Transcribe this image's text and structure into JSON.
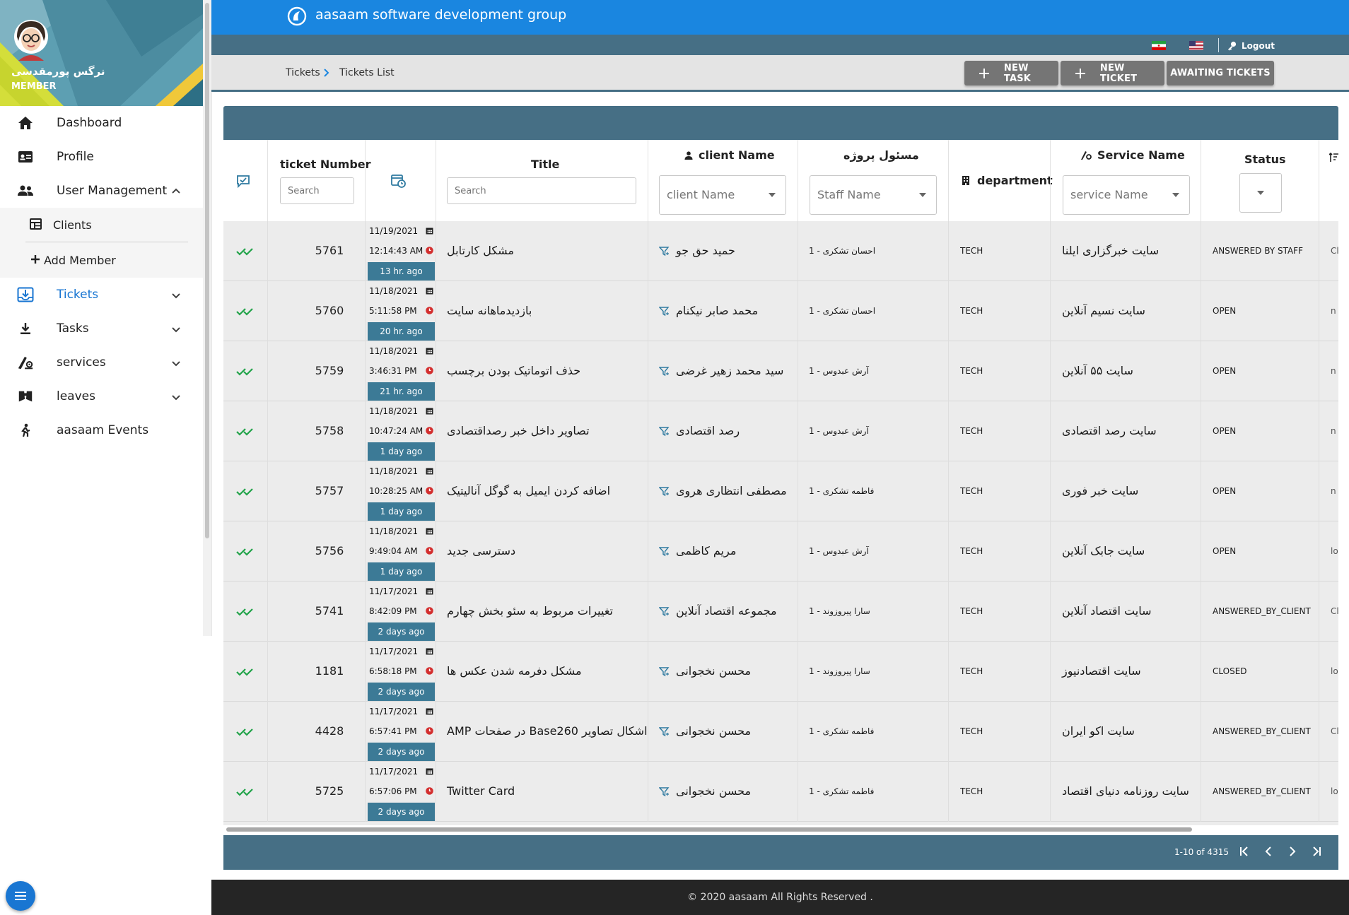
{
  "app": {
    "title": "aasaam software development group"
  },
  "sidebar": {
    "user_name": "نرگس پورمقدسی",
    "user_role": "MEMBER",
    "items": [
      {
        "label": "Dashboard",
        "icon": "home-icon"
      },
      {
        "label": "Profile",
        "icon": "id-card-icon"
      },
      {
        "label": "User Management",
        "icon": "users-icon",
        "expanded": true
      },
      {
        "label": "Tickets",
        "icon": "ticket-inbox-icon",
        "active": true
      },
      {
        "label": "Tasks",
        "icon": "task-icon"
      },
      {
        "label": "services",
        "icon": "services-icon"
      },
      {
        "label": "leaves",
        "icon": "leaves-icon"
      },
      {
        "label": "aasaam Events",
        "icon": "events-icon"
      }
    ],
    "sub_items": [
      {
        "label": "Clients",
        "icon": "table-icon"
      },
      {
        "label": "Add Member",
        "icon": "plus-icon"
      }
    ]
  },
  "header": {
    "logout_label": "Logout"
  },
  "breadcrumb": {
    "root": "Tickets",
    "current": "Tickets List"
  },
  "toolbar": {
    "new_task": "NEW TASK",
    "new_ticket": "NEW TICKET",
    "awaiting": "AWAITING TICKETS"
  },
  "table": {
    "headers": {
      "ticket_number": "ticket Number",
      "title": "Title",
      "client_name": "client Name",
      "staff": "مسئول پروژه",
      "department": "department",
      "service_name": "Service Name",
      "status": "Status"
    },
    "filters": {
      "ticket_search": "Search",
      "title_search": "Search",
      "client_placeholder": "client Name",
      "staff_placeholder": "Staff Name",
      "service_placeholder": "service Name"
    },
    "rows": [
      {
        "number": "5761",
        "date": "11/19/2021",
        "time": "12:14:43 AM",
        "ago": "13 hr. ago",
        "title": "مشکل کارتابل",
        "client": "حمید  حق جو",
        "staff": "احسان  تشکری - 1",
        "department": "TECH",
        "service": "سایت خبرگزاری ایلنا",
        "status": "ANSWERED BY STAFF",
        "extra": "Cl"
      },
      {
        "number": "5760",
        "date": "11/18/2021",
        "time": "5:11:58 PM",
        "ago": "20 hr. ago",
        "title": "بازدیدماهانه سایت",
        "client": "محمد صابر  نیکنام",
        "staff": "احسان  تشکری - 1",
        "department": "TECH",
        "service": "سایت نسیم آنلاین",
        "status": "OPEN",
        "extra": "n"
      },
      {
        "number": "5759",
        "date": "11/18/2021",
        "time": "3:46:31 PM",
        "ago": "21 hr. ago",
        "title": "حذف اتوماتیک بودن برچسب",
        "client": "سید محمد زهیر  غرضی",
        "staff": "آرش  عبدوس - 1",
        "department": "TECH",
        "service": "سایت ۵۵ آنلاین",
        "status": "OPEN",
        "extra": "n"
      },
      {
        "number": "5758",
        "date": "11/18/2021",
        "time": "10:47:24 AM",
        "ago": "1 day ago",
        "title": "تصاویر داخل خبر رصداقتصادی",
        "client": "رصد  اقتصادی",
        "staff": "آرش  عبدوس - 1",
        "department": "TECH",
        "service": "سایت رصد اقتصادی",
        "status": "OPEN",
        "extra": "n"
      },
      {
        "number": "5757",
        "date": "11/18/2021",
        "time": "10:28:25 AM",
        "ago": "1 day ago",
        "title": "اضافه کردن ایمیل به گوگل آنالیتیک",
        "client": "مصطفی  انتظاری هروی",
        "staff": "فاطمه  تشکری - 1",
        "department": "TECH",
        "service": "سایت خبر فوری",
        "status": "OPEN",
        "extra": "n"
      },
      {
        "number": "5756",
        "date": "11/18/2021",
        "time": "9:49:04 AM",
        "ago": "1 day ago",
        "title": "دسترسی جدید",
        "client": "مریم  کاظمی",
        "staff": "آرش  عبدوس - 1",
        "department": "TECH",
        "service": "سایت جابک آنلاین",
        "status": "OPEN",
        "extra": "lo"
      },
      {
        "number": "5741",
        "date": "11/17/2021",
        "time": "8:42:09 PM",
        "ago": "2 days ago",
        "title": "تغییرات مربوط به سئو بخش چهارم",
        "client": "مجموعه  اقتصاد آنلاین",
        "staff": "سارا  پیروزوند - 1",
        "department": "TECH",
        "service": "سایت اقتصاد آنلاین",
        "status": "ANSWERED_BY_CLIENT",
        "extra": "Cl"
      },
      {
        "number": "1181",
        "date": "11/17/2021",
        "time": "6:58:18 PM",
        "ago": "2 days ago",
        "title": "مشکل دفرمه شدن عکس ها",
        "client": "محسن  نخجوانی",
        "staff": "سارا  پیروزوند - 1",
        "department": "TECH",
        "service": "سایت اقتصادنیوز",
        "status": "CLOSED",
        "extra": "lo"
      },
      {
        "number": "4428",
        "date": "11/17/2021",
        "time": "6:57:41 PM",
        "ago": "2 days ago",
        "title": "AMP در صفحات Base260 اشکال تصاویر",
        "client": "محسن  نخجوانی",
        "staff": "فاطمه  تشکری - 1",
        "department": "TECH",
        "service": "سایت اکو ایران",
        "status": "ANSWERED_BY_CLIENT",
        "extra": "Cl"
      },
      {
        "number": "5725",
        "date": "11/17/2021",
        "time": "6:57:06 PM",
        "ago": "2 days ago",
        "title": "Twitter Card",
        "client": "محسن  نخجوانی",
        "staff": "فاطمه  تشکری - 1",
        "department": "TECH",
        "service": "سایت روزنامه دنیای اقتصاد",
        "status": "ANSWERED_BY_CLIENT",
        "extra": "lo"
      }
    ]
  },
  "pagination": {
    "range": "1-10 of 4315"
  },
  "footer": {
    "copyright": "© 2020 aasaam All Rights Reserved ."
  },
  "colors": {
    "primary": "#1a86e0",
    "teal_bar": "#466f85",
    "ago_badge": "#3c7a96",
    "check_green": "#22a34a",
    "clock_red": "#d32f2f",
    "button_grey": "#757575"
  }
}
